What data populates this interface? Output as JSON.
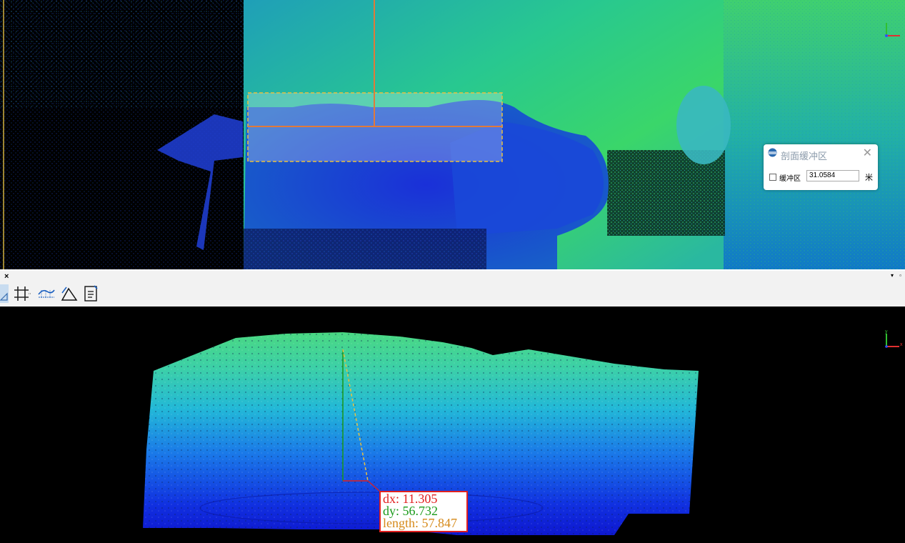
{
  "buffer_dialog": {
    "title": "剖面缓冲区",
    "close_symbol": "✕",
    "checkbox_label": "缓冲区",
    "checkbox_checked": false,
    "buffer_value": "31.0584",
    "unit": "米"
  },
  "panel": {
    "close_symbol": "×",
    "menu_symbol": "▾",
    "restore_symbol": "▫"
  },
  "toolbar": {
    "tools": [
      "measure-tool-icon",
      "grid-icon",
      "profile-icon",
      "angle-icon",
      "report-icon"
    ]
  },
  "axis_gizmo": {
    "x_label": "x",
    "y_label": "y"
  },
  "measurement": {
    "dx_label": "dx: 11.305",
    "dy_label": "dy: 56.732",
    "length_label": "length: 57.847"
  },
  "colors": {
    "dx": "#e02020",
    "dy": "#1a9a1a",
    "length": "#d68a1a",
    "selection_border": "#e8c040",
    "profile_line": "#e07a3a"
  }
}
